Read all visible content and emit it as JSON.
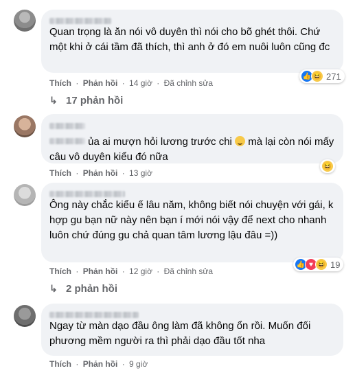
{
  "labels": {
    "like": "Thích",
    "reply": "Phản hồi",
    "separator": "·"
  },
  "comments": [
    {
      "text": "Quan trọng là ăn nói vô duyên thì nói cho bõ ghét thôi. Chứ một khi ở cái tầm đã thích, thì anh ở đó em nuôi luôn cũng đc",
      "time": "14 giờ",
      "edited": "Đã chỉnh sửa",
      "reactions": [
        "like",
        "haha"
      ],
      "reaction_count": "271",
      "replies": "17 phản hồi"
    },
    {
      "text_part1": "ủa ai mượn hỏi lương trước chi",
      "text_part2": "mà lại còn nói mấy câu vô duyên kiểu đó nữa",
      "time": "13 giờ",
      "reactions": [
        "haha"
      ]
    },
    {
      "text": "Ông này chắc kiểu ế lâu năm, không biết nói chuyện với gái, k hợp gu bạn nữ này nên bạn í mới nói vậy để next cho nhanh luôn chứ đúng gu chả quan tâm lương lậu đâu =))",
      "time": "12 giờ",
      "edited": "Đã chỉnh sửa",
      "reactions": [
        "like",
        "love",
        "haha"
      ],
      "reaction_count": "19",
      "replies": "2 phản hồi"
    },
    {
      "text": "Ngay từ màn dạo đầu ông làm đã không ổn rồi. Muốn đối phương mềm người ra thì phải dạo đầu tốt nha",
      "time": "9 giờ"
    }
  ],
  "icons": {
    "like": "thumbs-up-icon",
    "haha": "laughing-face-icon",
    "love": "heart-icon",
    "reply_arrow": "reply-arrow-icon",
    "emoji": "smile-emoji-icon"
  },
  "colors": {
    "bubble": "#f0f2f5",
    "meta": "#65676b",
    "like": "#1877f2",
    "love": "#f33e58",
    "haha": "#f7c948"
  }
}
